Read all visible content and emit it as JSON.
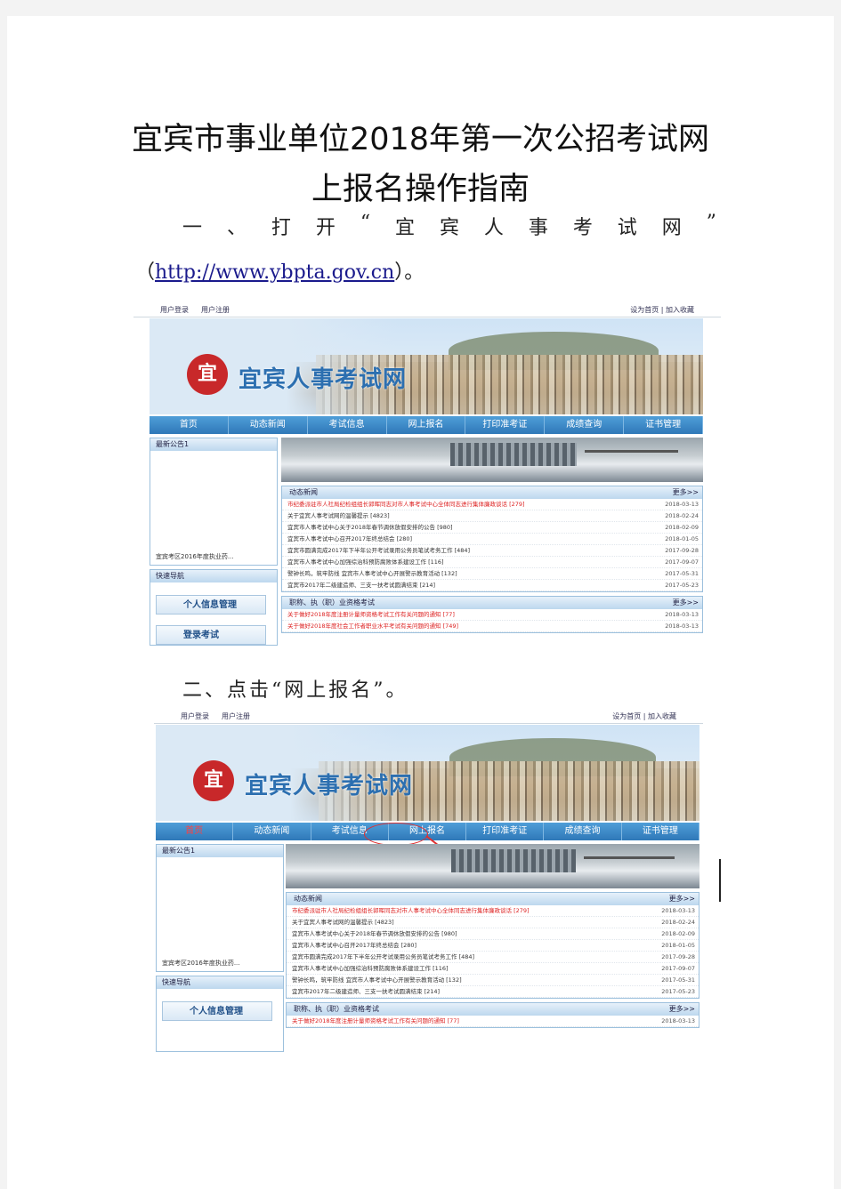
{
  "title_line1": "宜宾市事业单位2018年第一次公招考试网",
  "title_line2": "上报名操作指南",
  "step1_chars": [
    "一",
    "、",
    "打",
    "开",
    "“",
    "宜",
    "宾",
    "人",
    "事",
    "考",
    "试",
    "网",
    "”"
  ],
  "step1_open_paren": "（",
  "step1_url": "http://www.ybpta.gov.cn",
  "step1_close": "）。",
  "step2_text": "二、点击“网上报名”。",
  "screenshot": {
    "top_left_links": [
      "用户登录",
      "用户注册"
    ],
    "top_right_links": "设为首页 | 加入收藏",
    "logo_char": "宜",
    "site_name": "宜宾人事考试网",
    "nav": [
      "首页",
      "动态新闻",
      "考试信息",
      "网上报名",
      "打印准考证",
      "成绩查询",
      "证书管理"
    ],
    "notice_title": "最新公告1",
    "notice_item": "宜宾考区2016年度执业药...",
    "quick_title": "快速导航",
    "quick_btn1": "个人信息管理",
    "quick_btn2": "登录考试",
    "news_title": "动态新闻",
    "more": "更多>>",
    "news_rows": [
      {
        "text": "市纪委派驻市人社局纪检组组长郭晖同志对市人事考试中心全体同志进行集体廉政谈话 [279]",
        "date": "2018-03-13"
      },
      {
        "text": "关于宜宾人事考试网的温馨提示 [4823]",
        "date": "2018-02-24"
      },
      {
        "text": "宜宾市人事考试中心关于2018年春节调休放假安排的公告 [980]",
        "date": "2018-02-09"
      },
      {
        "text": "宜宾市人事考试中心召开2017年终总结会 [280]",
        "date": "2018-01-05"
      },
      {
        "text": "宜宾市圆满完成2017年下半年公开考试录用公务员笔试考务工作 [484]",
        "date": "2017-09-28"
      },
      {
        "text": "宜宾市人事考试中心加强综治科预防腐败体系建设工作 [116]",
        "date": "2017-09-07"
      },
      {
        "text": "警钟长鸣，筑牢防线 宜宾市人事考试中心开展警示教育活动 [132]",
        "date": "2017-05-31"
      },
      {
        "text": "宜宾市2017年二级建造师、三支一扶考试圆满结束 [214]",
        "date": "2017-05-23"
      }
    ],
    "cert_title": "职称、执（职）业资格考试",
    "cert_rows": [
      {
        "text": "关于做好2018年度注册计量师资格考试工作有关问题的通知 [77]",
        "date": "2018-03-13"
      },
      {
        "text": "关于做好2018年度社会工作者职业水平考试有关问题的通知 [749]",
        "date": "2018-03-13"
      }
    ]
  }
}
